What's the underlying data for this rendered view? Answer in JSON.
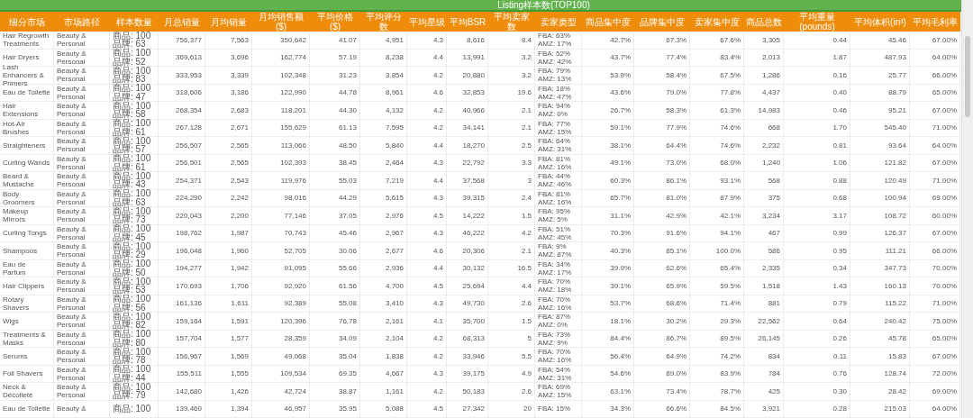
{
  "table": {
    "group_header": "Listing样本数(TOP100)",
    "columns": [
      {
        "label": "细分市场",
        "kind": "text"
      },
      {
        "label": "市场路径",
        "kind": "text"
      },
      {
        "label": "样本数量",
        "kind": "text"
      },
      {
        "label": "月总销量",
        "kind": "number"
      },
      {
        "label": "月均销量",
        "kind": "number"
      },
      {
        "label": "月均销售额($)",
        "kind": "number"
      },
      {
        "label": "平均价格($)",
        "kind": "number"
      },
      {
        "label": "平均评分数",
        "kind": "number"
      },
      {
        "label": "平均星级",
        "kind": "number"
      },
      {
        "label": "平均BSR",
        "kind": "number"
      },
      {
        "label": "平均卖家数",
        "kind": "number"
      },
      {
        "label": "卖家类型",
        "kind": "text"
      },
      {
        "label": "商品集中度",
        "kind": "number"
      },
      {
        "label": "品牌集中度",
        "kind": "number"
      },
      {
        "label": "卖家集中度",
        "kind": "number"
      },
      {
        "label": "商品总数",
        "kind": "number"
      },
      {
        "label": "平均重量(pounds)",
        "kind": "number"
      },
      {
        "label": "平均体积(in³)",
        "kind": "number"
      },
      {
        "label": "平均毛利率",
        "kind": "number"
      }
    ],
    "rows": [
      [
        "Hair Regrowth Treatments",
        "Beauty & Personal",
        [
          "商品: 100",
          "品牌: 63"
        ],
        "756,377",
        "7,563",
        "350,642",
        "41.07",
        "4,951",
        "4.3",
        "8,616",
        "8.4",
        [
          "FBA: 63%",
          "AMZ: 17%"
        ],
        "42.7%",
        "67.3%",
        "67.6%",
        "3,305",
        "0.44",
        "45.46",
        "67.00%"
      ],
      [
        "Hair Dryers",
        "Beauty & Personal",
        [
          "商品: 100",
          "品牌: 52"
        ],
        "369,613",
        "3,696",
        "162,774",
        "57.19",
        "8,238",
        "4.4",
        "13,991",
        "3.2",
        [
          "FBA: 52%",
          "AMZ: 42%"
        ],
        "43.7%",
        "77.4%",
        "83.4%",
        "2,013",
        "1.87",
        "487.93",
        "64.00%"
      ],
      [
        "Lash Enhancers & Primers",
        "Beauty & Personal",
        [
          "商品: 100",
          "品牌: 83"
        ],
        "333,953",
        "3,339",
        "102,348",
        "31.23",
        "3,854",
        "4.2",
        "20,880",
        "3.2",
        [
          "FBA: 79%",
          "AMZ: 13%"
        ],
        "53.9%",
        "58.4%",
        "67.5%",
        "1,286",
        "0.16",
        "25.77",
        "66.00%"
      ],
      [
        "Eau de Toilette",
        "Beauty & Personal",
        [
          "商品: 100",
          "品牌: 47"
        ],
        "318,606",
        "3,186",
        "122,990",
        "44.78",
        "8,961",
        "4.6",
        "32,853",
        "19.6",
        [
          "FBA: 18%",
          "AMZ: 47%"
        ],
        "43.6%",
        "79.0%",
        "77.8%",
        "4,437",
        "0.40",
        "88.79",
        "65.00%"
      ],
      [
        "Hair Extensions",
        "Beauty & Personal",
        [
          "商品: 100",
          "品牌: 58"
        ],
        "268,354",
        "2,683",
        "118,201",
        "44.30",
        "4,132",
        "4.2",
        "40,966",
        "2.1",
        [
          "FBA: 94%",
          "AMZ: 0%"
        ],
        "26.7%",
        "58.3%",
        "61.3%",
        "14,983",
        "0.46",
        "95.21",
        "67.00%"
      ],
      [
        "Hot-Air Brushes",
        "Beauty & Personal",
        [
          "商品: 100",
          "品牌: 61"
        ],
        "267,128",
        "2,671",
        "155,629",
        "61.13",
        "7,595",
        "4.2",
        "34,141",
        "2.1",
        [
          "FBA: 77%",
          "AMZ: 15%"
        ],
        "59.1%",
        "77.9%",
        "74.6%",
        "668",
        "1.70",
        "545.40",
        "71.00%"
      ],
      [
        "Straighteners",
        "Beauty & Personal",
        [
          "商品: 100",
          "品牌: 57"
        ],
        "256,507",
        "2,565",
        "113,066",
        "48.50",
        "5,840",
        "4.4",
        "18,270",
        "2.5",
        [
          "FBA: 64%",
          "AMZ: 31%"
        ],
        "38.1%",
        "64.4%",
        "74.6%",
        "2,232",
        "0.81",
        "93.64",
        "64.00%"
      ],
      [
        "Curling Wands",
        "Beauty & Personal",
        [
          "商品: 100",
          "品牌: 61"
        ],
        "256,501",
        "2,565",
        "102,393",
        "38.45",
        "2,464",
        "4.3",
        "22,792",
        "3.3",
        [
          "FBA: 81%",
          "AMZ: 16%"
        ],
        "49.1%",
        "73.0%",
        "68.0%",
        "1,240",
        "1.06",
        "121.82",
        "67.00%"
      ],
      [
        "Beard & Mustache",
        "Beauty & Personal",
        [
          "商品: 100",
          "品牌: 43"
        ],
        "254,371",
        "2,543",
        "119,976",
        "55.03",
        "7,219",
        "4.4",
        "37,568",
        "3",
        [
          "FBA: 44%",
          "AMZ: 46%"
        ],
        "60.3%",
        "86.1%",
        "93.1%",
        "568",
        "0.88",
        "120.49",
        "71.00%"
      ],
      [
        "Body Groomers",
        "Beauty & Personal",
        [
          "商品: 100",
          "品牌: 63"
        ],
        "224,290",
        "2,242",
        "98,016",
        "44.29",
        "5,615",
        "4.3",
        "39,315",
        "2.4",
        [
          "FBA: 81%",
          "AMZ: 16%"
        ],
        "65.7%",
        "81.0%",
        "87.9%",
        "375",
        "0.68",
        "100.94",
        "69.00%"
      ],
      [
        "Makeup Mirrors",
        "Beauty & Personal",
        [
          "商品: 100",
          "品牌: 73"
        ],
        "220,043",
        "2,200",
        "77,146",
        "37.05",
        "2,976",
        "4.5",
        "14,222",
        "1.5",
        [
          "FBA: 95%",
          "AMZ: 5%"
        ],
        "31.1%",
        "42.9%",
        "42.1%",
        "3,234",
        "3.17",
        "108.72",
        "60.00%"
      ],
      [
        "Curling Tongs",
        "Beauty & Personal",
        [
          "商品: 100",
          "品牌: 45"
        ],
        "198,762",
        "1,987",
        "70,743",
        "45.46",
        "2,967",
        "4.3",
        "46,222",
        "4.2",
        [
          "FBA: 51%",
          "AMZ: 45%"
        ],
        "70.3%",
        "91.6%",
        "94.1%",
        "467",
        "0.99",
        "126.37",
        "67.00%"
      ],
      [
        "Shampoos",
        "Beauty & Personal",
        [
          "商品: 100",
          "品牌: 29"
        ],
        "196,048",
        "1,960",
        "52,705",
        "30.06",
        "2,677",
        "4.6",
        "20,306",
        "2.1",
        [
          "FBA: 9%",
          "AMZ: 87%"
        ],
        "40.3%",
        "85.1%",
        "100.0%",
        "586",
        "0.95",
        "111.21",
        "66.00%"
      ],
      [
        "Eau de Parfum",
        "Beauty & Personal",
        [
          "商品: 100",
          "品牌: 50"
        ],
        "194,277",
        "1,942",
        "91,095",
        "55.66",
        "2,936",
        "4.4",
        "30,132",
        "16.5",
        [
          "FBA: 34%",
          "AMZ: 17%"
        ],
        "39.9%",
        "62.6%",
        "65.4%",
        "2,335",
        "0.34",
        "347.73",
        "70.00%"
      ],
      [
        "Hair Clippers",
        "Beauty & Personal",
        [
          "商品: 100",
          "品牌: 53"
        ],
        "170,693",
        "1,706",
        "92,920",
        "61.56",
        "4,700",
        "4.5",
        "25,694",
        "4.4",
        [
          "FBA: 70%",
          "AMZ: 18%"
        ],
        "39.1%",
        "65.9%",
        "59.5%",
        "1,518",
        "1.43",
        "160.13",
        "70.00%"
      ],
      [
        "Rotary Shavers",
        "Beauty & Personal",
        [
          "商品: 100",
          "品牌: 56"
        ],
        "161,136",
        "1,611",
        "92,389",
        "55.08",
        "3,410",
        "4.3",
        "49,730",
        "2.6",
        [
          "FBA: 70%",
          "AMZ: 16%"
        ],
        "53.7%",
        "68.6%",
        "71.4%",
        "881",
        "0.79",
        "115.22",
        "71.00%"
      ],
      [
        "Wigs",
        "Beauty & Personal",
        [
          "商品: 100",
          "品牌: 82"
        ],
        "159,164",
        "1,591",
        "120,396",
        "76.78",
        "2,161",
        "4.1",
        "35,700",
        "1.5",
        [
          "FBA: 87%",
          "AMZ: 0%"
        ],
        "18.1%",
        "30.2%",
        "29.3%",
        "22,562",
        "0.64",
        "240.42",
        "75.00%"
      ],
      [
        "Treatments & Masks",
        "Beauty & Personal",
        [
          "商品: 100",
          "品牌: 80"
        ],
        "157,704",
        "1,577",
        "28,359",
        "34.09",
        "2,104",
        "4.2",
        "68,313",
        "5",
        [
          "FBA: 73%",
          "AMZ: 9%"
        ],
        "84.4%",
        "86.7%",
        "89.5%",
        "26,145",
        "0.26",
        "45.78",
        "65.00%"
      ],
      [
        "Serums",
        "Beauty & Personal",
        [
          "商品: 100",
          "品牌: 78"
        ],
        "156,967",
        "1,569",
        "49,068",
        "35.04",
        "1,838",
        "4.2",
        "33,946",
        "5.5",
        [
          "FBA: 70%",
          "AMZ: 16%"
        ],
        "56.4%",
        "64.9%",
        "74.2%",
        "834",
        "0.11",
        "15.83",
        "67.00%"
      ],
      [
        "Foil Shavers",
        "Beauty & Personal",
        [
          "商品: 100",
          "品牌: 44"
        ],
        "155,511",
        "1,555",
        "109,534",
        "69.35",
        "4,667",
        "4.3",
        "39,175",
        "4.9",
        [
          "FBA: 54%",
          "AMZ: 31%"
        ],
        "54.6%",
        "89.0%",
        "83.9%",
        "784",
        "0.76",
        "128.74",
        "72.00%"
      ],
      [
        "Neck & Décolleté",
        "Beauty & Personal",
        [
          "商品: 100",
          "品牌: 79"
        ],
        "142,680",
        "1,426",
        "42,724",
        "38.87",
        "1,161",
        "4.2",
        "50,183",
        "2.6",
        [
          "FBA: 69%",
          "AMZ: 15%"
        ],
        "63.1%",
        "73.4%",
        "78.7%",
        "425",
        "0.30",
        "28.42",
        "69.00%"
      ],
      [
        "Eau de Toilette",
        "Beauty &",
        [
          "商品: 100"
        ],
        "139,460",
        "1,394",
        "46,957",
        "35.95",
        "5,088",
        "4.5",
        "27,342",
        "20",
        [
          "FBA: 15%"
        ],
        "34.3%",
        "66.6%",
        "84.5%",
        "3,921",
        "0.28",
        "215.03",
        "64.00%"
      ]
    ]
  }
}
